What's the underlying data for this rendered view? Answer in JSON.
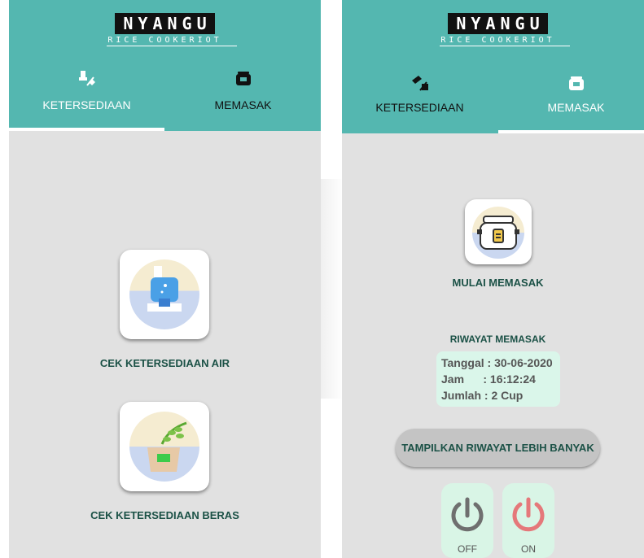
{
  "left": {
    "app": {
      "logo": "NYANGU",
      "subtitle": "RICE COOKERIOT"
    },
    "tabs": [
      {
        "label": "KETERSEDIAAN",
        "icon": "hand-bottle-icon"
      },
      {
        "label": "MEMASAK",
        "icon": "rice-cooker-icon"
      }
    ],
    "selected_tab": 0,
    "actions": [
      {
        "label": "CEK KETERSEDIAAN AIR",
        "icon": "water-bottle-icon"
      },
      {
        "label": "CEK KETERSEDIAAN BERAS",
        "icon": "rice-sack-icon"
      }
    ]
  },
  "right": {
    "app": {
      "logo": "NYANGU",
      "subtitle": "RICE COOKERIOT"
    },
    "tabs": [
      {
        "label": "KETERSEDIAAN",
        "icon": "hand-bottle-icon"
      },
      {
        "label": "MEMASAK",
        "icon": "rice-cooker-icon"
      }
    ],
    "selected_tab": 1,
    "start_label": "MULAI MEMASAK",
    "history_title": "RIWAYAT MEMASAK",
    "history": {
      "tanggal": "Tanggal : 30-06-2020",
      "jam": "Jam      : 16:12:24",
      "jumlah": "Jumlah : 2 Cup"
    },
    "more_button": "TAMPILKAN RIWAYAT LEBIH BANYAK",
    "power": {
      "off_label": "OFF",
      "on_label": "ON"
    }
  },
  "colors": {
    "header": "#54b7b0",
    "background": "#e1e1e1",
    "accent_text": "#1b5146",
    "history_card": "#daf6ea",
    "power_off": "#6f6f6f",
    "power_on": "#e5787a"
  }
}
